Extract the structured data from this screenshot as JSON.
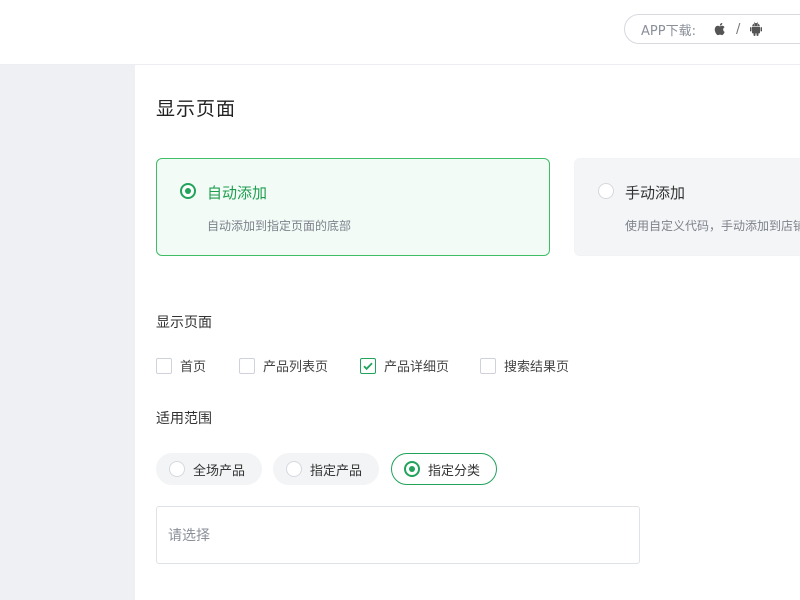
{
  "header": {
    "app_download_label": "APP下载:",
    "separator": "/",
    "icons": [
      "apple-icon",
      "android-icon"
    ]
  },
  "page": {
    "title": "显示页面"
  },
  "mode_cards": {
    "auto": {
      "title": "自动添加",
      "desc": "自动添加到指定页面的底部",
      "selected": true
    },
    "manual": {
      "title": "手动添加",
      "desc": "使用自定义代码，手动添加到店铺",
      "selected": false
    }
  },
  "display_pages": {
    "label": "显示页面",
    "options": [
      {
        "label": "首页",
        "checked": false
      },
      {
        "label": "产品列表页",
        "checked": false
      },
      {
        "label": "产品详细页",
        "checked": true
      },
      {
        "label": "搜索结果页",
        "checked": false
      }
    ]
  },
  "scope": {
    "label": "适用范围",
    "options": [
      {
        "label": "全场产品",
        "selected": false
      },
      {
        "label": "指定产品",
        "selected": false
      },
      {
        "label": "指定分类",
        "selected": true
      }
    ]
  },
  "category_select": {
    "placeholder": "请选择"
  },
  "colors": {
    "accent": "#21a35b",
    "card_selected_bg": "#f3fbf7",
    "sidebar_bg": "#eef0f3"
  }
}
